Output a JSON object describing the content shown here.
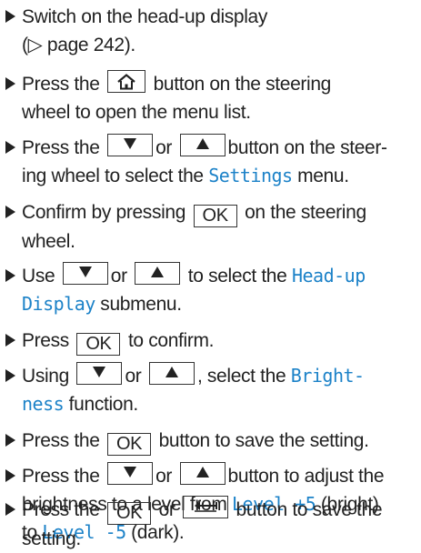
{
  "steps": [
    {
      "a": "Switch on the head-up display",
      "b": "(▷ page 242)."
    },
    {
      "a": "Press the",
      "b": "button on the steering",
      "c": "wheel to open the menu list."
    },
    {
      "a": "Press the",
      "b": "or",
      "c": "button on the steer-",
      "d": "ing wheel to select the",
      "e": "Settings",
      "f": "menu."
    },
    {
      "a": "Confirm by pressing",
      "b": "on the steering",
      "c": "wheel."
    },
    {
      "a": "Use",
      "b": "or",
      "c": "to select the",
      "d": "Head-up",
      "e": "Display",
      "f": "submenu."
    },
    {
      "a": "Press",
      "b": "to confirm."
    },
    {
      "a": "Using",
      "b": "or",
      "c": ", select the",
      "d": "Bright-",
      "e": "ness",
      "f": "function."
    },
    {
      "a": "Press the",
      "b": "button to save the setting."
    },
    {
      "a": "Press the",
      "b": "or",
      "c": "button to adjust the",
      "d": "brightness to a level from",
      "e": "Level +5",
      "f": "(bright)",
      "g": "to",
      "h": "Level -5",
      "i": "(dark)."
    },
    {
      "a": "Press the",
      "b": "or",
      "c": "button to save the",
      "d": "setting."
    }
  ],
  "buttons": {
    "ok": "OK"
  },
  "colors": {
    "highlight": "#1c82c8",
    "text": "#222222"
  },
  "icons": [
    "home-icon",
    "arrow-down-icon",
    "arrow-up-icon",
    "back-icon"
  ]
}
